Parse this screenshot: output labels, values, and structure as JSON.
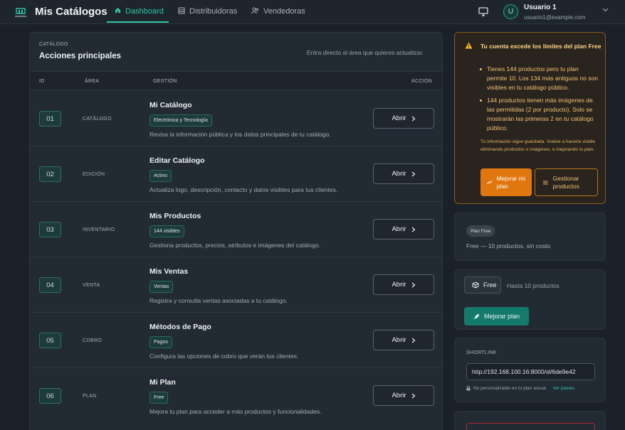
{
  "header": {
    "app_title": "Mis Catálogos",
    "logo_icon": "store-logo-icon",
    "tabs": [
      {
        "label": "Dashboard",
        "icon": "home-icon",
        "active": true
      },
      {
        "label": "Distribuidoras",
        "icon": "building-icon",
        "active": false
      },
      {
        "label": "Vendedoras",
        "icon": "users-icon",
        "active": false
      }
    ],
    "user": {
      "initial": "U",
      "name": "Usuario 1",
      "email": "usuario1@example.com"
    }
  },
  "main": {
    "eyebrow": "CATÁLOGO",
    "title": "Acciones principales",
    "hint": "Entra directo al área que quieres actualizar.",
    "columns": [
      "ID",
      "ÁREA",
      "GESTIÓN",
      "ACCIÓN"
    ],
    "rows": [
      {
        "id": "01",
        "area": "CATÁLOGO",
        "title": "Mi Catálogo",
        "badge": "Electrónica y Tecnología",
        "description": "Revisa la información pública y los datos principales de tu catálogo.",
        "action": "Abrir"
      },
      {
        "id": "02",
        "area": "EDICIÓN",
        "title": "Editar Catálogo",
        "badge": "Activo",
        "description": "Actualiza logo, descripción, contacto y datos visibles para tus clientes.",
        "action": "Abrir"
      },
      {
        "id": "03",
        "area": "INVENTARIO",
        "title": "Mis Productos",
        "badge": "144 visibles",
        "description": "Gestiona productos, precios, atributos e imágenes del catálogo.",
        "action": "Abrir"
      },
      {
        "id": "04",
        "area": "VENTA",
        "title": "Mis Ventas",
        "badge": "Ventas",
        "description": "Registra y consulta ventas asociadas a tu catálogo.",
        "action": "Abrir"
      },
      {
        "id": "05",
        "area": "COBRO",
        "title": "Métodos de Pago",
        "badge": "Pagos",
        "description": "Configura las opciones de cobro que verán tus clientes.",
        "action": "Abrir"
      },
      {
        "id": "06",
        "area": "PLAN",
        "title": "Mi Plan",
        "badge": "Free",
        "description": "Mejora tu plan para acceder a más productos y funcionalidades.",
        "action": "Abrir"
      }
    ]
  },
  "warning": {
    "title": "Tu cuenta excede los límites del plan Free",
    "items": [
      "Tienes 144 productos pero tu plan permite 10. Los 134 más antiguos no son visibles en tu catálogo público.",
      "144 productos tienen más imágenes de las permitidas (2 por producto). Solo se mostrarán las primeras 2 en tu catálogo público."
    ],
    "note": "Tu información sigue guardada. Vuelve a hacerla visible eliminando productos o imágenes, o mejorando tu plan.",
    "upgrade_label": "Mejorar mi plan",
    "manage_label": "Gestionar productos"
  },
  "plan": {
    "pill": "Plan Free",
    "description": "Free — 10 productos, sin costo"
  },
  "plan_box": {
    "chip": "Free",
    "hint": "Hasta 10 productos",
    "button": "Mejorar plan"
  },
  "shortlink": {
    "label": "SHORTLINK",
    "value": "http://192.168.100.16:8000/sl/6de9e42",
    "note": "No personalizable en tu plan actual.",
    "link": "Ver planes"
  },
  "colors": {
    "accent": "#2ec6a6",
    "warning": "#e0770e",
    "danger": "#b3262e"
  }
}
